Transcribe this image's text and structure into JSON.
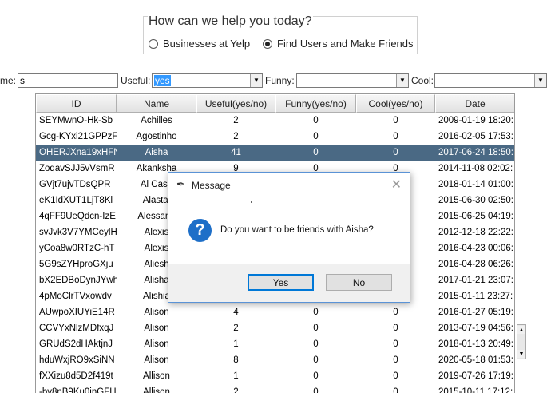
{
  "help_group": {
    "title": "How can we help you today?",
    "options": [
      {
        "label": "Businesses at Yelp",
        "selected": false
      },
      {
        "label": "Find Users and Make Friends",
        "selected": true
      }
    ]
  },
  "filters": {
    "name_label": "me:",
    "name_value": "s",
    "useful_label": "Useful:",
    "useful_value": "yes",
    "funny_label": "Funny:",
    "funny_value": "",
    "cool_label": "Cool:",
    "cool_value": ""
  },
  "table": {
    "columns": [
      "ID",
      "Name",
      "Useful(yes/no)",
      "Funny(yes/no)",
      "Cool(yes/no)",
      "Date"
    ],
    "rows": [
      {
        "id": "SEYMwnO-Hk-Sb",
        "name": "Achilles",
        "useful": "2",
        "funny": "0",
        "cool": "0",
        "date": "2009-01-19 18:20:"
      },
      {
        "id": "Gcg-KYxi21GPPzF",
        "name": "Agostinho",
        "useful": "2",
        "funny": "0",
        "cool": "0",
        "date": "2016-02-05 17:53:"
      },
      {
        "id": "OHERJXna19xHFN",
        "name": "Aisha",
        "useful": "41",
        "funny": "0",
        "cool": "0",
        "date": "2017-06-24 18:50:"
      },
      {
        "id": "ZoqavSJJ5vVsmR",
        "name": "Akanksha",
        "useful": "9",
        "funny": "0",
        "cool": "0",
        "date": "2014-11-08 02:02:"
      },
      {
        "id": "GVjt7ujvTDsQPR",
        "name": "Al Case",
        "useful": "",
        "funny": "",
        "cool": "",
        "date": "2018-01-14 01:00:"
      },
      {
        "id": "eK1IdXUT1LjT8Kl",
        "name": "Alastai",
        "useful": "",
        "funny": "",
        "cool": "",
        "date": "2015-06-30 02:50:"
      },
      {
        "id": "4qFF9UeQdcn-IzE",
        "name": "Alessand",
        "useful": "",
        "funny": "",
        "cool": "",
        "date": "2015-06-25 04:19:"
      },
      {
        "id": "svJvk3V7YMCeylH",
        "name": "Alexis",
        "useful": "",
        "funny": "",
        "cool": "",
        "date": "2012-12-18 22:22:"
      },
      {
        "id": "yCoa8w0RTzC-hT",
        "name": "Alexis",
        "useful": "",
        "funny": "",
        "cool": "",
        "date": "2016-04-23 00:06:"
      },
      {
        "id": "5G9sZYHproGXju",
        "name": "Aliesh",
        "useful": "",
        "funny": "",
        "cool": "",
        "date": "2016-04-28 06:26:"
      },
      {
        "id": "bX2EDBoDynJYwh",
        "name": "Alisha",
        "useful": "",
        "funny": "",
        "cool": "",
        "date": "2017-01-21 23:07:"
      },
      {
        "id": "4pMoClrTVxowdv",
        "name": "Alishia",
        "useful": "",
        "funny": "",
        "cool": "",
        "date": "2015-01-11 23:27:"
      },
      {
        "id": "AUwpoXIUYiE14R",
        "name": "Alison",
        "useful": "4",
        "funny": "0",
        "cool": "0",
        "date": "2016-01-27 05:19:"
      },
      {
        "id": "CCVYxNlzMDfxqJ",
        "name": "Alison",
        "useful": "2",
        "funny": "0",
        "cool": "0",
        "date": "2013-07-19 04:56:"
      },
      {
        "id": "GRUdS2dHAktjnJ",
        "name": "Alison",
        "useful": "1",
        "funny": "0",
        "cool": "0",
        "date": "2018-01-13 20:49:"
      },
      {
        "id": "hduWxjRO9xSiNN",
        "name": "Alison",
        "useful": "8",
        "funny": "0",
        "cool": "0",
        "date": "2020-05-18 01:53:"
      },
      {
        "id": "fXXizu8d5D2f419t",
        "name": "Allison",
        "useful": "1",
        "funny": "0",
        "cool": "0",
        "date": "2019-07-26 17:19:"
      },
      {
        "id": "-bv8nB9Ku0inGFH",
        "name": "Allison",
        "useful": "2",
        "funny": "0",
        "cool": "0",
        "date": "2015-10-11 17:12:"
      }
    ],
    "selected_row": 2
  },
  "dialog": {
    "title": "Message",
    "message": "Do you want to be friends with Aisha?",
    "yes_label": "Yes",
    "no_label": "No"
  },
  "icons": {
    "radio": "radio-icon",
    "combo_arrow": "chevron-down-icon",
    "dialog": "feather-icon",
    "close": "close-icon",
    "question": "question-icon"
  },
  "colors": {
    "selection": "#4a6984",
    "question_icon": "#1e6fc8",
    "default_button_border": "#0078d7",
    "text_selection": "#3399ff"
  }
}
